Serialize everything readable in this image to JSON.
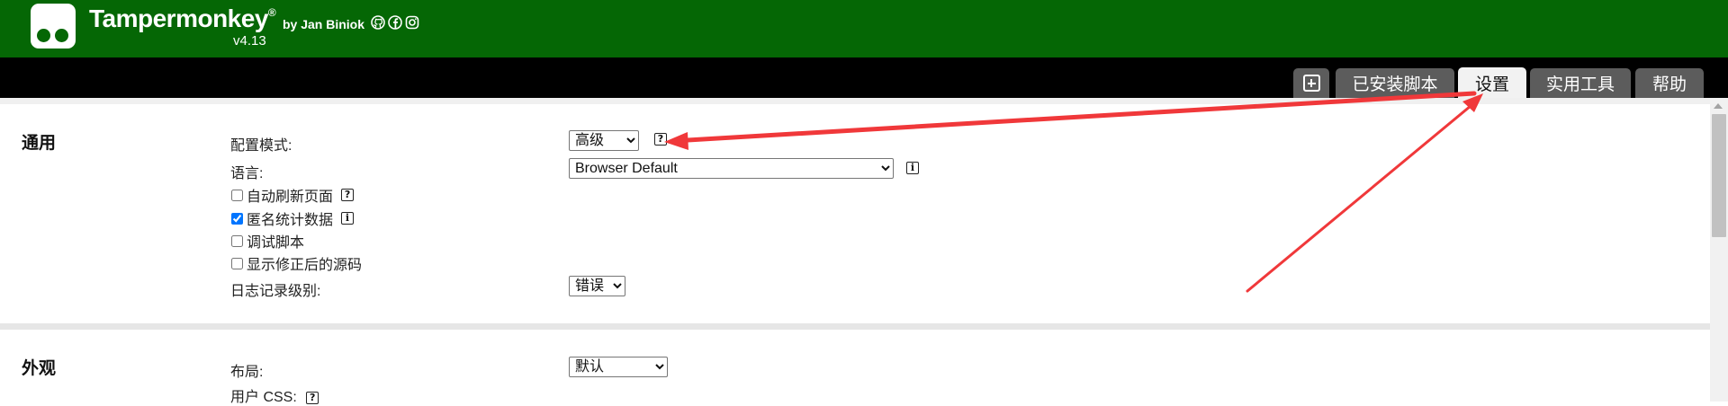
{
  "header": {
    "brand": "Tampermonkey",
    "registered": "®",
    "byline": "by Jan Biniok",
    "version": "v4.13",
    "social_icons": [
      "github-icon",
      "facebook-icon",
      "instagram-icon"
    ],
    "background_color": "#056705"
  },
  "tabs": [
    {
      "label": "",
      "icon": "plus-box-icon",
      "active": false
    },
    {
      "label": "已安装脚本",
      "active": false
    },
    {
      "label": "设置",
      "active": true
    },
    {
      "label": "实用工具",
      "active": false
    },
    {
      "label": "帮助",
      "active": false
    }
  ],
  "general": {
    "title": "通用",
    "config_mode": {
      "label": "配置模式:",
      "value": "高级",
      "help_icon": "help-icon"
    },
    "language": {
      "label": "语言:",
      "value": "Browser Default",
      "info_icon": "info-icon"
    },
    "auto_reload": {
      "label": "自动刷新页面",
      "checked": false
    },
    "anon_stats": {
      "label": "匿名统计数据",
      "checked": true
    },
    "debug_scripts": {
      "label": "调试脚本",
      "checked": false
    },
    "show_fixed_source": {
      "label": "显示修正后的源码",
      "checked": false
    },
    "log_level": {
      "label": "日志记录级别:",
      "value": "错误"
    }
  },
  "appearance": {
    "title": "外观",
    "layout": {
      "label": "布局:",
      "value": "默认"
    },
    "user_css": {
      "label": "用户 CSS:"
    }
  },
  "annotation_color": "#f0383a"
}
